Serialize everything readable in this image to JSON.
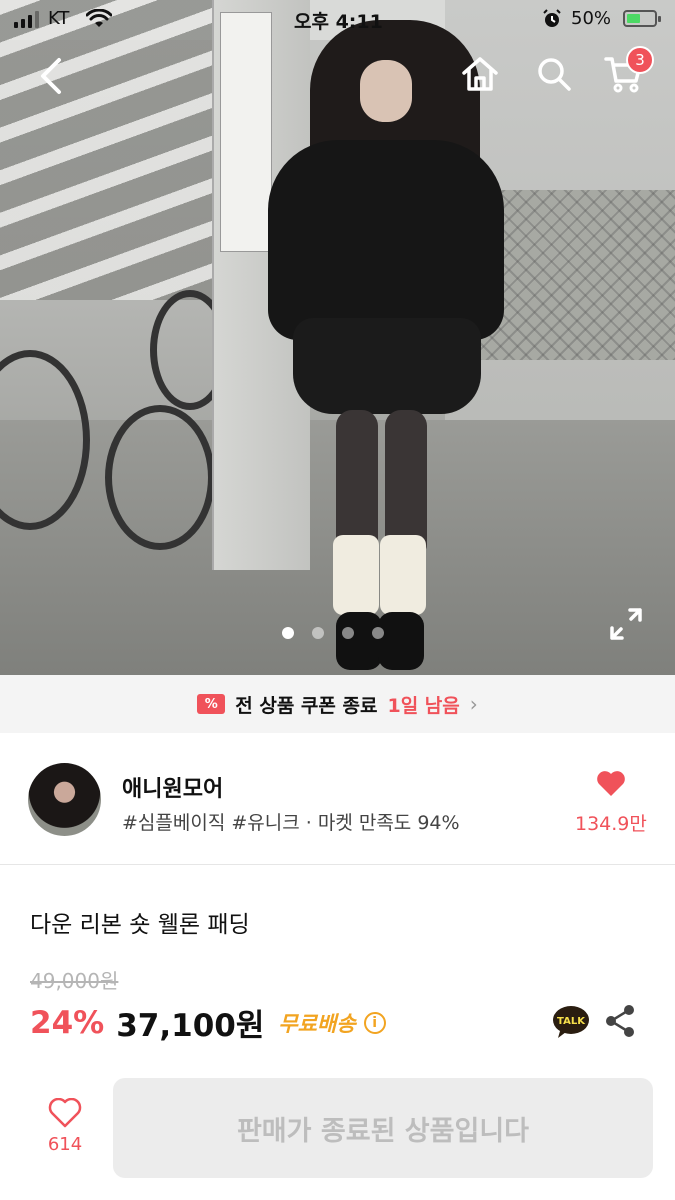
{
  "status_bar": {
    "carrier": "KT",
    "time": "오후 4:11",
    "battery_percent_label": "50%",
    "battery_level": 0.5
  },
  "nav": {
    "cart_count": "3"
  },
  "gallery": {
    "image_count": 4,
    "active_index": 0
  },
  "coupon_banner": {
    "text": "전 상품 쿠폰 종료",
    "remaining": "1일 남음"
  },
  "shop": {
    "name": "애니원모어",
    "tags_rating": "#심플베이직 #유니크 · 마켓 만족도 94%",
    "like_count": "134.9만"
  },
  "product": {
    "title": "다운 리본 숏 웰론 패딩",
    "original_price": "49,000원",
    "discount": "24%",
    "price": "37,100원",
    "shipping": "무료배송"
  },
  "talk_label": "TALK",
  "bottom_bar": {
    "wish_count": "614",
    "status_button": "판매가 종료된 상품입니다"
  },
  "colors": {
    "accent": "#f0525a",
    "shipping": "#f2a421",
    "disabled_bg": "#ececec",
    "disabled_text": "#bdbdbd"
  }
}
